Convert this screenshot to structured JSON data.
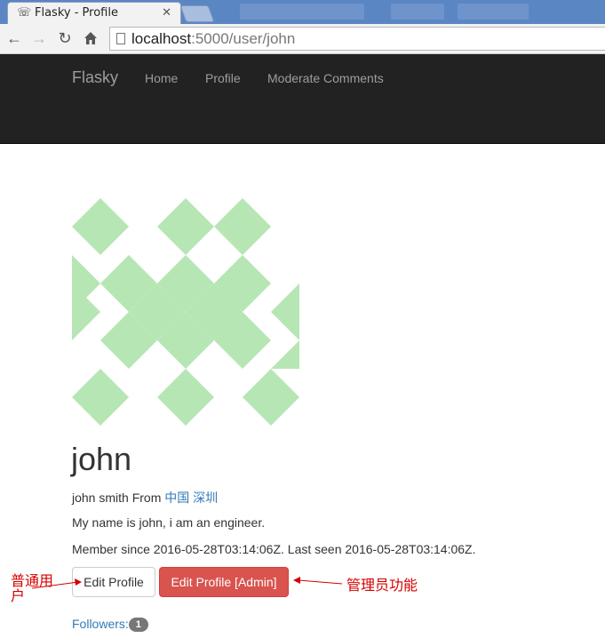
{
  "browser": {
    "tab_title": "Flasky - Profile",
    "url_host": "localhost",
    "url_rest": ":5000/user/john"
  },
  "navbar": {
    "brand": "Flasky",
    "links": [
      "Home",
      "Profile",
      "Moderate Comments"
    ]
  },
  "profile": {
    "username": "john",
    "name": "john smith",
    "from_label": "From",
    "location": "中国 深圳",
    "about": "My name is john, i am an engineer.",
    "member_since": "Member since 2016-05-28T03:14:06Z. Last seen 2016-05-28T03:14:06Z.",
    "avatar_color": "#b6e6b4"
  },
  "buttons": {
    "edit_profile": "Edit Profile",
    "edit_profile_admin": "Edit Profile [Admin]"
  },
  "followers": {
    "label": "Followers:",
    "count": "1"
  },
  "annotations": {
    "user_note": "普通用户",
    "admin_note": "管理员功能"
  },
  "colors": {
    "navbar_bg": "#222222",
    "link": "#337ab7",
    "danger": "#d9534f",
    "annotation": "#d40000"
  }
}
